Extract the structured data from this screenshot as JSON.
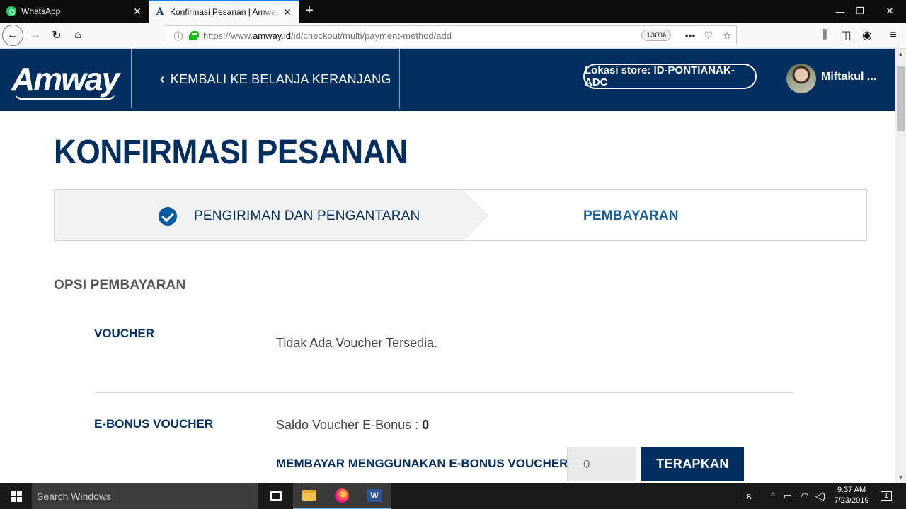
{
  "browser": {
    "tabs": [
      {
        "title": "WhatsApp",
        "favicon": "whatsapp-icon",
        "active": false
      },
      {
        "title": "Konfirmasi Pesanan | Amway Indonesia",
        "favicon": "amway-icon",
        "active": true
      }
    ],
    "url_prefix": "https://www.",
    "url_host": "amway.id",
    "url_path": "/id/checkout/multi/payment-method/add",
    "zoom": "130%",
    "icons": {
      "back": "back-arrow-icon",
      "forward": "forward-arrow-icon",
      "reload": "reload-icon",
      "home": "home-icon",
      "info": "info-icon",
      "lock": "lock-icon",
      "more": "more-icon",
      "pocket": "pocket-icon",
      "bookmark": "star-icon",
      "library": "library-icon",
      "sidebar": "sidebar-icon",
      "account": "account-icon",
      "menu": "hamburger-icon"
    }
  },
  "header": {
    "logo": "Amway",
    "back_link": "KEMBALI KE BELANJA KERANJANG",
    "store": "Lokasi store: ID-PONTIANAK-ADC",
    "user": "Miftakul ..."
  },
  "page": {
    "title": "KONFIRMASI PESANAN",
    "steps": [
      {
        "label": "PENGIRIMAN DAN PENGANTARAN",
        "done": true
      },
      {
        "label": "PEMBAYARAN",
        "done": false
      }
    ],
    "section_title": "OPSI PEMBAYARAN",
    "voucher": {
      "label": "VOUCHER",
      "text": "Tidak Ada Voucher Tersedia."
    },
    "ebonus": {
      "label": "E-BONUS VOUCHER",
      "balance_label": "Saldo Voucher E-Bonus : ",
      "balance_value": "0",
      "pay_label": "MEMBAYAR MENGGUNAKAN E-BONUS VOUCHER",
      "input_placeholder": "0",
      "apply_label": "TERAPKAN"
    }
  },
  "taskbar": {
    "search": "Search Windows",
    "time": "9:37 AM",
    "date": "7/23/2019",
    "notification_count": "1"
  }
}
